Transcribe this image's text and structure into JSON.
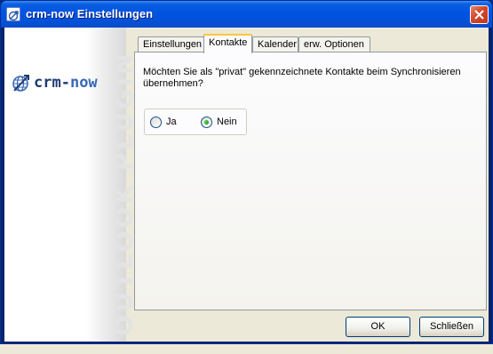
{
  "window": {
    "title": "crm-now Einstellungen"
  },
  "brand": {
    "logo_prefix": "crm-",
    "logo_suffix": "now",
    "vertical_text": "OUTLOOK PLUGIN"
  },
  "tabs": [
    {
      "label": "Einstellungen",
      "active": false
    },
    {
      "label": "Kontakte",
      "active": true
    },
    {
      "label": "Kalender",
      "active": false
    },
    {
      "label": "erw. Optionen",
      "active": false
    }
  ],
  "contacts_panel": {
    "question": "Möchten Sie als \"privat\" gekennzeichnete Kontakte beim Synchronisieren übernehmen?",
    "options": [
      {
        "label": "Ja",
        "selected": false
      },
      {
        "label": "Nein",
        "selected": true
      }
    ]
  },
  "buttons": {
    "ok": "OK",
    "close": "Schließen"
  },
  "colors": {
    "titlebar": "#0054E3",
    "dialog_bg": "#ECE9D8",
    "active_tab_highlight": "#FFC83C",
    "logo": "#1F3A74"
  }
}
